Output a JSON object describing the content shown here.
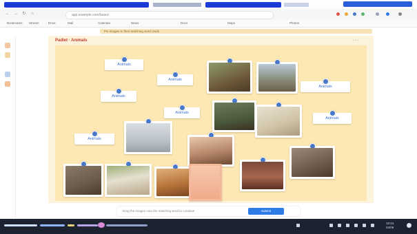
{
  "browser": {
    "url": "app.example.com/board",
    "bookmarks": [
      "Bookmarks",
      "Stream",
      "Drive",
      "Mail",
      "Calendar",
      "News",
      "Docs",
      "Maps",
      "Photos"
    ]
  },
  "banner": {
    "text": "Pin images to their matching word cards"
  },
  "board": {
    "title": "Padlet · Animals",
    "menu_label": "• • •",
    "word_cards": [
      {
        "label": "Animals"
      },
      {
        "label": "Animals"
      },
      {
        "label": "Animals"
      },
      {
        "label": "Animals"
      },
      {
        "label": "Animals"
      },
      {
        "label": "Animals"
      },
      {
        "label": "Animals"
      }
    ],
    "photos": [
      {
        "subject": "animal-photo"
      },
      {
        "subject": "animal-photo"
      },
      {
        "subject": "animal-photo"
      },
      {
        "subject": "animal-photo"
      },
      {
        "subject": "animal-photo"
      },
      {
        "subject": "animal-photo"
      },
      {
        "subject": "animal-photo"
      },
      {
        "subject": "animal-photo"
      },
      {
        "subject": "animal-photo"
      },
      {
        "subject": "animal-photo"
      },
      {
        "subject": "animal-photo"
      },
      {
        "subject": "animal-photo"
      }
    ]
  },
  "action_bar": {
    "text": "Drag the images onto the matching word to continue",
    "button_label": "Submit"
  },
  "taskbar": {
    "time": "10:24",
    "date": "04/05"
  },
  "colors": {
    "board_bg": "#fde8b4",
    "accent": "#2f7be5",
    "pin": "#4a78c8",
    "title": "#c0392b"
  }
}
